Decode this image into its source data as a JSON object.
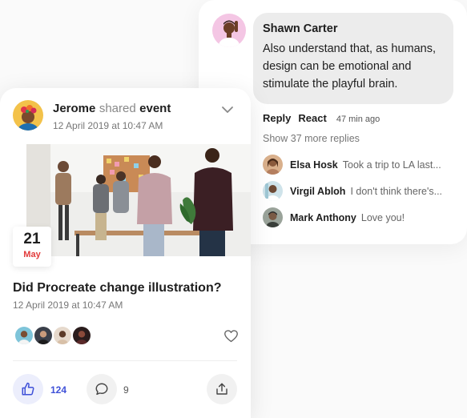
{
  "comment": {
    "author": "Shawn Carter",
    "text": "Also understand that, as humans, design can be emotional and stimulate the playful brain.",
    "reply_label": "Reply",
    "react_label": "React",
    "time": "47 min ago",
    "more_replies": "Show 37 more replies",
    "replies": [
      {
        "name": "Elsa Hosk",
        "text": "Took a trip to LA last..."
      },
      {
        "name": "Virgil Abloh",
        "text": "I don't think there's..."
      },
      {
        "name": "Mark Anthony",
        "text": "Love you!"
      }
    ]
  },
  "event_post": {
    "author": "Jerome",
    "shared_word": "shared",
    "event_word": "event",
    "posted_date": "12 April 2019 at 10:47 AM",
    "badge_day": "21",
    "badge_month": "May",
    "title": "Did Procreate change illustration?",
    "event_date": "12 April 2019 at 10:47 AM",
    "like_count": "124",
    "comment_count": "9",
    "icons": {
      "options": "chevron-down-icon",
      "favorite": "heart-icon",
      "like": "thumbs-up-icon",
      "comment": "comment-bubble-icon",
      "share": "share-icon"
    }
  },
  "colors": {
    "accent": "#3f51d8",
    "date_month": "#e23b3b",
    "bubble": "#ececec"
  }
}
